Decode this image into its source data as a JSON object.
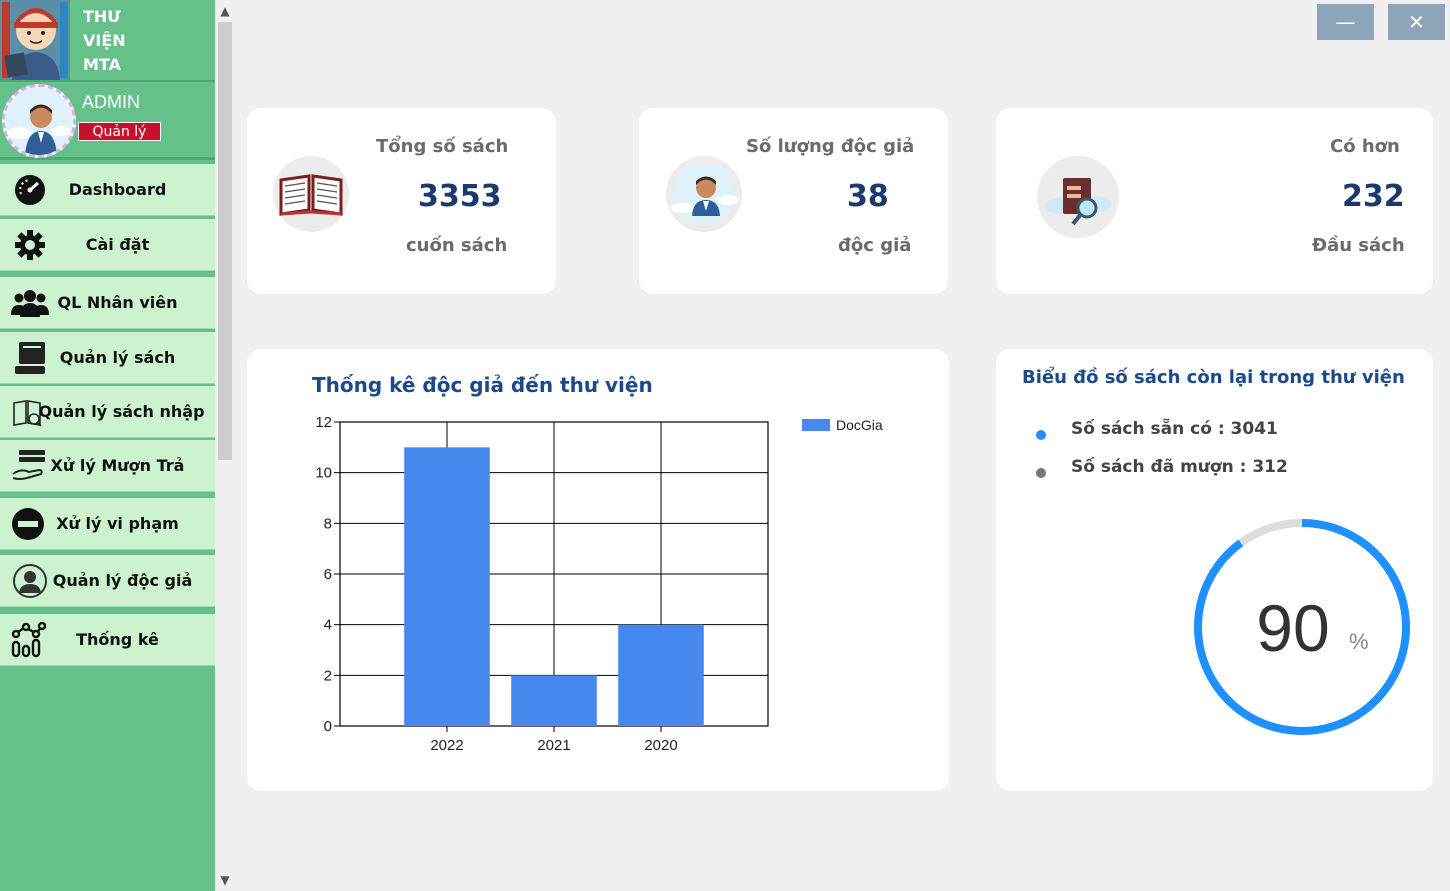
{
  "sidebar": {
    "logo_lines": [
      "THƯ",
      "VIỆN",
      "MTA"
    ],
    "user_name": "ADMIN",
    "user_role": "Quản lý",
    "items": [
      {
        "label": "Dashboard",
        "icon": "dashboard-gauge-icon"
      },
      {
        "label": "Cài đặt",
        "icon": "gear-icon"
      },
      {
        "label": "QL Nhân viên",
        "icon": "people-icon"
      },
      {
        "label": "Quản lý sách",
        "icon": "book-stack-icon"
      },
      {
        "label": "Quản lý sách nhập",
        "icon": "book-import-icon"
      },
      {
        "label": "Xử lý Mượn Trả",
        "icon": "hand-book-icon"
      },
      {
        "label": "Xử lý vi phạm",
        "icon": "no-entry-icon"
      },
      {
        "label": "Quản lý độc giả",
        "icon": "user-circle-icon"
      },
      {
        "label": "Thống kê",
        "icon": "statistics-icon"
      }
    ]
  },
  "window": {
    "minimize_label": "—",
    "close_label": "✕"
  },
  "stats": [
    {
      "title": "Tổng số sách",
      "value": "3353",
      "sub": "cuốn sách",
      "icon": "open-book-icon"
    },
    {
      "title": "Số lượng độc giả",
      "value": "38",
      "sub": "độc giả",
      "icon": "reader-person-icon"
    },
    {
      "title": "Có hơn",
      "value": "232",
      "sub": "Đầu sách",
      "icon": "book-search-icon"
    }
  ],
  "bar_chart_title": "Thống kê độc giả đến thư viện",
  "pie_panel": {
    "title": "Biểu đồ số sách còn lại trong thư viện",
    "items": [
      {
        "label": "Số sách sẵn có : 3041",
        "color": "#1e90ff"
      },
      {
        "label": "Số sách đã mượn : 312",
        "color": "#777777"
      }
    ],
    "gauge_value": "90",
    "gauge_unit": "%",
    "gauge_fraction": 0.9,
    "gauge_color": "#1e90ff",
    "gauge_track_color": "#dddddd"
  },
  "chart_data": {
    "type": "bar",
    "categories": [
      "2022",
      "2021",
      "2020"
    ],
    "series": [
      {
        "name": "DocGia",
        "values": [
          11,
          2,
          4
        ]
      }
    ],
    "ylim": [
      0,
      12
    ],
    "yticks": [
      "0",
      "2",
      "4",
      "6",
      "8",
      "10",
      "12"
    ],
    "grid": true,
    "legend": "top-right",
    "color": "#4589ee"
  }
}
